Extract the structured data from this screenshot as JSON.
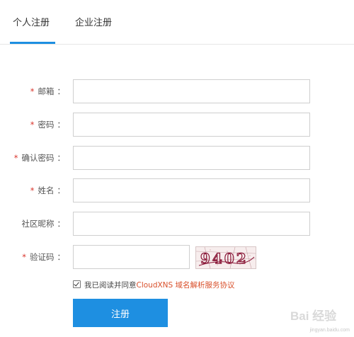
{
  "tabs": [
    {
      "label": "个人注册",
      "active": true
    },
    {
      "label": "企业注册",
      "active": false
    }
  ],
  "form": {
    "required_mark": "*",
    "colon": "：",
    "fields": {
      "email": {
        "label": "邮箱",
        "value": "",
        "required": true
      },
      "password": {
        "label": "密码",
        "value": "",
        "required": true
      },
      "confirm_password": {
        "label": "确认密码",
        "value": "",
        "required": true
      },
      "name": {
        "label": "姓名",
        "value": "",
        "required": true
      },
      "nickname": {
        "label": "社区昵称",
        "value": "",
        "required": false
      },
      "captcha": {
        "label": "验证码",
        "value": "",
        "required": true,
        "image_text": "9402"
      }
    },
    "agreement": {
      "checked": true,
      "text": "我已阅读并同意",
      "link": "CloudXNS 域名解析服务协议"
    },
    "submit_label": "注册"
  },
  "watermark": {
    "text": "jingyan.baidu.com",
    "logo": "Bai 经验"
  },
  "colors": {
    "accent": "#1e8fe1",
    "required": "#d9342b",
    "link": "#d9502b"
  }
}
